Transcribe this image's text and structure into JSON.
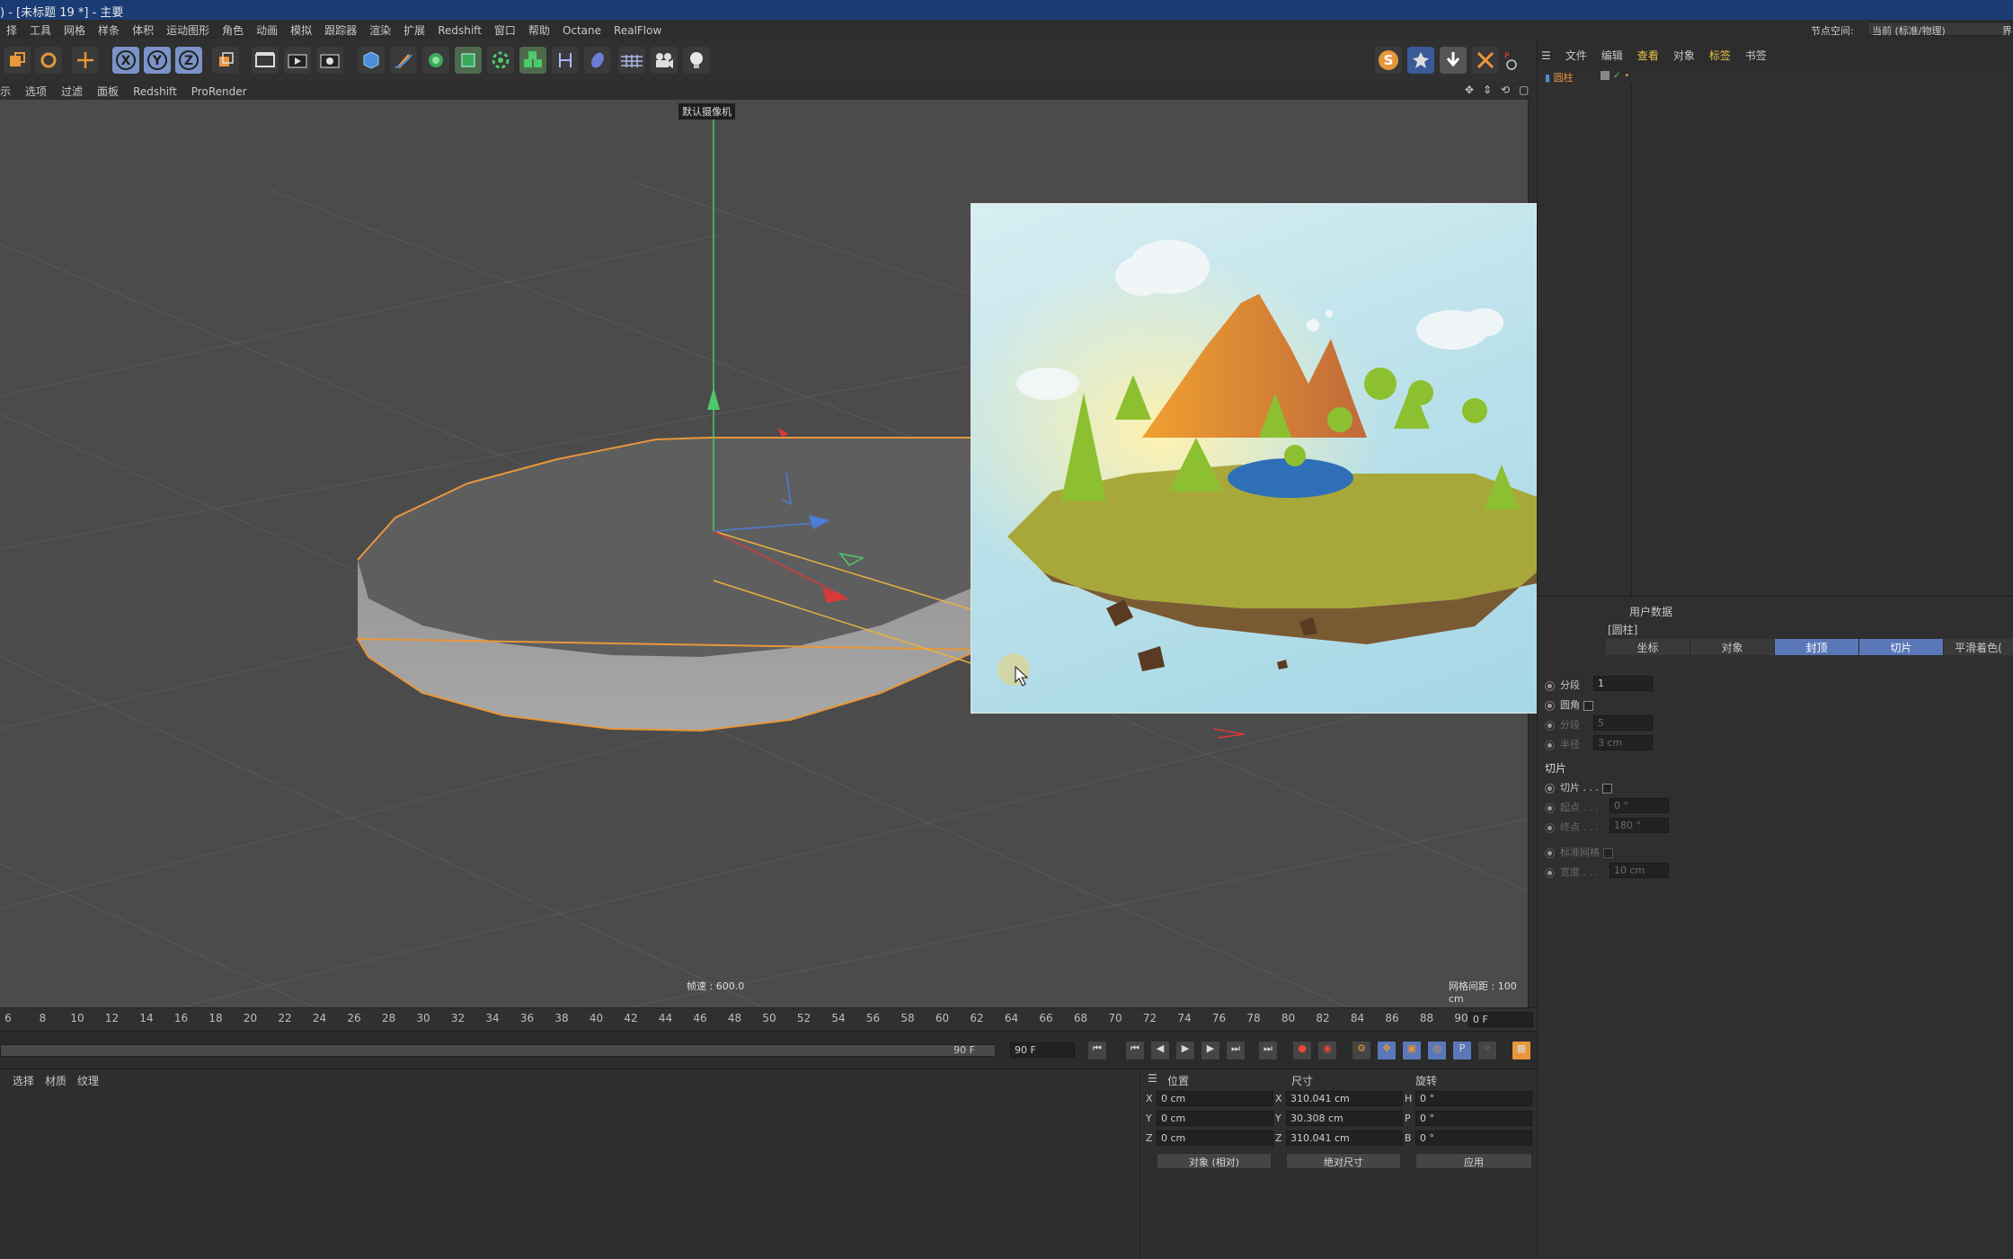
{
  "title": ") - [未标题 19 *] - 主要",
  "menu": [
    "择",
    "工具",
    "网格",
    "样条",
    "体积",
    "运动图形",
    "角色",
    "动画",
    "模拟",
    "跟踪器",
    "渲染",
    "扩展",
    "Redshift",
    "窗口",
    "帮助",
    "Octane",
    "RealFlow"
  ],
  "node_space": {
    "label": "节点空间:",
    "value": "当前 (标准/物理)",
    "layout": "界面"
  },
  "viewport_menu": [
    "示",
    "选项",
    "过滤",
    "面板",
    "Redshift",
    "ProRender"
  ],
  "camera_label": "默认摄像机",
  "fps_label": "帧速 : 600.0",
  "grid_label": "网格间距 : 100 cm",
  "objects_panel": {
    "menu": [
      "文件",
      "编辑",
      "查看",
      "对象",
      "标签",
      "书签"
    ],
    "items": [
      {
        "name": "圆柱"
      }
    ]
  },
  "timeline": {
    "ticks": [
      "6",
      "8",
      "10",
      "12",
      "14",
      "16",
      "18",
      "20",
      "22",
      "24",
      "26",
      "28",
      "30",
      "32",
      "34",
      "36",
      "38",
      "40",
      "42",
      "44",
      "46",
      "48",
      "50",
      "52",
      "54",
      "56",
      "58",
      "60",
      "62",
      "64",
      "66",
      "68",
      "70",
      "72",
      "74",
      "76",
      "78",
      "80",
      "82",
      "84",
      "86",
      "88",
      "90"
    ],
    "current_frame": "0 F",
    "end_frame": "90 F",
    "end_frame_field": "90 F"
  },
  "material_tabs": [
    "选择",
    "材质",
    "纹理"
  ],
  "attr": {
    "tabs_top": [
      "用户数据"
    ],
    "object_name": "[圆柱]",
    "tabs": [
      {
        "label": "坐标",
        "active": false
      },
      {
        "label": "对象",
        "active": false
      },
      {
        "label": "封顶",
        "active": true
      },
      {
        "label": "切片",
        "active": true
      },
      {
        "label": "平滑着色(",
        "active": false
      }
    ],
    "rows": [
      {
        "label": "分段",
        "value": "1",
        "dim": false
      },
      {
        "label": "圆角",
        "value": "",
        "dim": false,
        "checkbox": true
      },
      {
        "label": "分段",
        "value": "5",
        "dim": true
      },
      {
        "label": "半径",
        "value": "3 cm",
        "dim": true
      }
    ],
    "slice_section": "切片",
    "slice_rows": [
      {
        "label": "切片 . . .",
        "value": "",
        "checkbox": true,
        "dim": false
      },
      {
        "label": "起点 . . .",
        "value": "0 °",
        "dim": true
      },
      {
        "label": "终点 . . .",
        "value": "180 °",
        "dim": true
      },
      {
        "label": "标准网格",
        "value": "",
        "checkbox": true,
        "dim": true
      },
      {
        "label": "宽度 . . .",
        "value": "10 cm",
        "dim": true
      }
    ]
  },
  "coords": {
    "headers": [
      "位置",
      "尺寸",
      "旋转"
    ],
    "rows": [
      {
        "axis": "X",
        "pos": "0 cm",
        "size_axis": "X",
        "size": "310.041 cm",
        "rot_axis": "H",
        "rot": "0 °"
      },
      {
        "axis": "Y",
        "pos": "0 cm",
        "size_axis": "Y",
        "size": "30.308 cm",
        "rot_axis": "P",
        "rot": "0 °"
      },
      {
        "axis": "Z",
        "pos": "0 cm",
        "size_axis": "Z",
        "size": "310.041 cm",
        "rot_axis": "B",
        "rot": "0 °"
      }
    ],
    "mode": "对象 (相对)",
    "size_mode": "绝对尺寸",
    "apply": "应用"
  },
  "colors": {
    "accent": "#5a78b8",
    "selection": "#e8963a",
    "title_bar": "#1a3b73"
  }
}
